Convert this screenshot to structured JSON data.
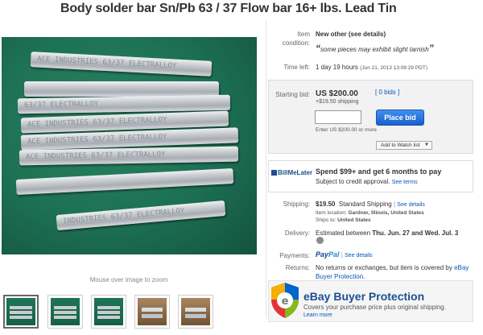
{
  "listing": {
    "title": "Body solder bar Sn/Pb 63 / 37 Flow bar 16+ lbs. Lead Tin"
  },
  "gallery": {
    "bar_imprints": [
      "ACE   INDUSTRIES   63/37  ELECTRALLOY",
      "ACE   INDUSTRIES   63/37  ELECTRALLOY",
      "63/37 ELECTRALLOY",
      "ACE   INDUSTRIES   63/37  ELECTRALLOY",
      "ACE   INDUSTRIES   63/37  ELECTRALLOY",
      "",
      "INDUSTRIES   63/37  ELECTRALLOY"
    ],
    "caption": "Mouse over image to zoom",
    "thumbnails": [
      "thumb-1",
      "thumb-2",
      "thumb-3",
      "thumb-4",
      "thumb-5"
    ]
  },
  "details": {
    "condition_label": "Item condition:",
    "condition_value": "New other (see details)",
    "condition_note": "some pieces may exhibit slight tarnish",
    "time_left_label": "Time left:",
    "time_left_value": "1 day 19 hours",
    "time_left_date": "(Jun 21, 2013  13:08:29 PDT)"
  },
  "bidding": {
    "starting_bid_label": "Starting bid:",
    "starting_bid_value": "US $200.00",
    "bids_link": "[ 0 bids ]",
    "shipping_note": "+$19.50 shipping",
    "bid_input_value": "",
    "place_bid_label": "Place bid",
    "enter_note": "Enter US $200.00 or more",
    "watch_label": "Add to Watch list"
  },
  "promo": {
    "logo_text": "BillMeLater",
    "headline": "Spend $99+ and get 6 months to pay",
    "sub": "Subject to credit approval.",
    "terms_link": "See terms"
  },
  "shipping": {
    "label": "Shipping:",
    "price": "$19.50",
    "method": "Standard Shipping",
    "details_link": "See details",
    "location_label": "Item location:",
    "location": "Gardner, Illinois, United States",
    "ships_to_label": "Ships to:",
    "ships_to": "United States"
  },
  "delivery": {
    "label": "Delivery:",
    "text": "Estimated between",
    "dates": "Thu. Jun. 27 and Wed. Jul. 3"
  },
  "payments": {
    "label": "Payments:",
    "paypal_a": "Pay",
    "paypal_b": "Pal",
    "details_link": "See details"
  },
  "returns": {
    "label": "Returns:",
    "text": "No returns or exchanges, but item is covered by",
    "link": "eBay Buyer Protection."
  },
  "protection": {
    "title": "eBay Buyer Protection",
    "sub": "Covers your purchase price plus original shipping.",
    "link": "Learn more"
  },
  "colors": {
    "link": "#0654ba",
    "place_bid": "#2a73dd",
    "felt_green": "#1b6e52",
    "brand_blue": "#1d4f91"
  }
}
